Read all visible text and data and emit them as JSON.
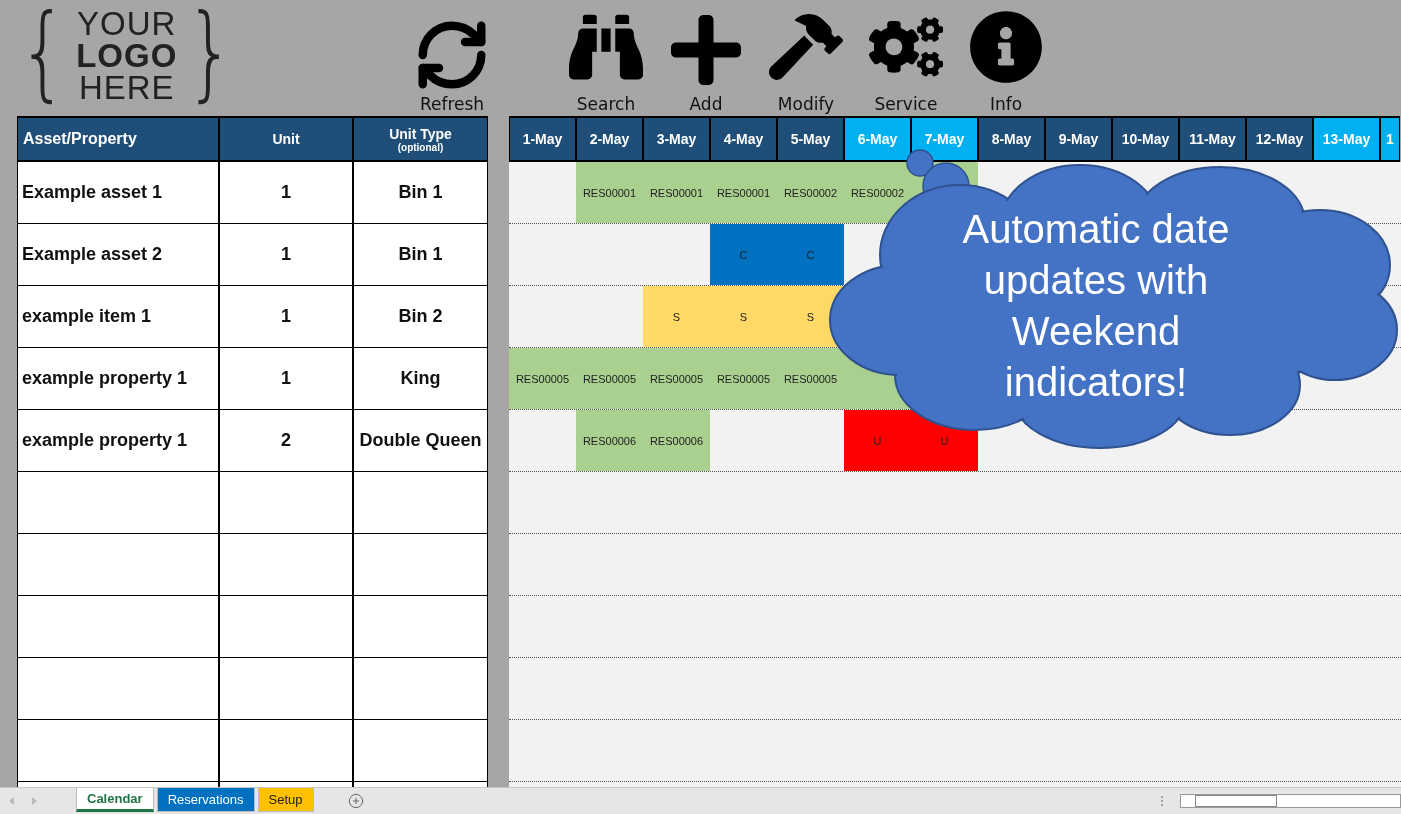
{
  "logo": {
    "open": "{",
    "lines": [
      "YOUR",
      "LOGO",
      "HERE"
    ],
    "close": "}"
  },
  "refresh_button": {
    "label": "Refresh"
  },
  "toolbar": [
    {
      "label": "Search",
      "kind": "search"
    },
    {
      "label": "Add",
      "kind": "add"
    },
    {
      "label": "Modify",
      "kind": "modify"
    },
    {
      "label": "Service",
      "kind": "service"
    },
    {
      "label": "Info",
      "kind": "info"
    }
  ],
  "table": {
    "columns": [
      {
        "label": "Asset/Property"
      },
      {
        "label": "Unit"
      },
      {
        "label": "Unit Type",
        "note": "(optional)"
      }
    ],
    "rows": [
      [
        "Example asset 1",
        "1",
        "Bin 1"
      ],
      [
        "Example asset 2",
        "1",
        "Bin 1"
      ],
      [
        "example item 1",
        "1",
        "Bin 2"
      ],
      [
        "example property 1",
        "1",
        "King"
      ],
      [
        "example property 1",
        "2",
        "Double Queen"
      ]
    ]
  },
  "calendar": {
    "days": [
      {
        "label": "1-May",
        "weekend": false
      },
      {
        "label": "2-May",
        "weekend": false
      },
      {
        "label": "3-May",
        "weekend": false
      },
      {
        "label": "4-May",
        "weekend": false
      },
      {
        "label": "5-May",
        "weekend": false
      },
      {
        "label": "6-May",
        "weekend": true
      },
      {
        "label": "7-May",
        "weekend": true
      },
      {
        "label": "8-May",
        "weekend": false
      },
      {
        "label": "9-May",
        "weekend": false
      },
      {
        "label": "10-May",
        "weekend": false
      },
      {
        "label": "11-May",
        "weekend": false
      },
      {
        "label": "12-May",
        "weekend": false
      },
      {
        "label": "13-May",
        "weekend": true
      },
      {
        "label": "1",
        "weekend": true
      }
    ],
    "rows": [
      {
        "cells": [
          {},
          {
            "text": "RES00001",
            "color": "#a9d08e"
          },
          {
            "text": "RES00001",
            "color": "#a9d08e"
          },
          {
            "text": "RES00001",
            "color": "#a9d08e"
          },
          {
            "text": "RES00002",
            "color": "#a9d08e"
          },
          {
            "text": "RES00002",
            "color": "#a9d08e"
          },
          {
            "color": "#a9d08e"
          }
        ]
      },
      {
        "cells": [
          {},
          {},
          {},
          {
            "text": "C",
            "color": "#0070c0"
          },
          {
            "text": "C",
            "color": "#0070c0"
          }
        ]
      },
      {
        "cells": [
          {},
          {},
          {
            "text": "S",
            "color": "#ffd966"
          },
          {
            "text": "S",
            "color": "#ffd966"
          },
          {
            "text": "S",
            "color": "#ffd966"
          }
        ]
      },
      {
        "cells": [
          {
            "text": "RES00005",
            "color": "#a9d08e"
          },
          {
            "text": "RES00005",
            "color": "#a9d08e"
          },
          {
            "text": "RES00005",
            "color": "#a9d08e"
          },
          {
            "text": "RES00005",
            "color": "#a9d08e"
          },
          {
            "text": "RES00005",
            "color": "#a9d08e"
          },
          {
            "color": "#a9d08e"
          }
        ]
      },
      {
        "cells": [
          {},
          {
            "text": "RES00006",
            "color": "#a9d08e"
          },
          {
            "text": "RES00006",
            "color": "#a9d08e"
          },
          {},
          {},
          {
            "text": "U",
            "color": "#ff0000"
          },
          {
            "text": "U",
            "color": "#ff0000"
          }
        ]
      }
    ]
  },
  "callout": {
    "text": "Automatic date updates with Weekend indicators!"
  },
  "sheet_tabs": [
    {
      "label": "Calendar",
      "selected": true,
      "color": "#217346"
    },
    {
      "label": "Reservations",
      "selected": false,
      "color": "#0070c0"
    },
    {
      "label": "Setup",
      "selected": false,
      "color": "#ffc000"
    }
  ]
}
